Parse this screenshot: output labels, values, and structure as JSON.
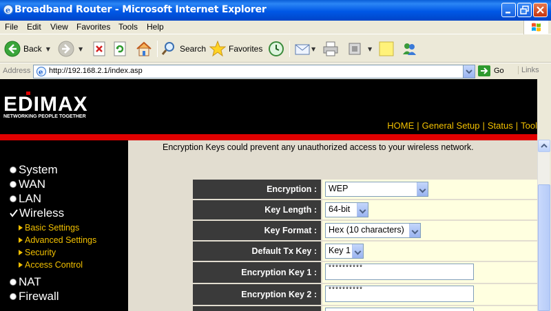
{
  "window": {
    "title": "Broadband Router - Microsoft Internet Explorer"
  },
  "menubar": [
    "File",
    "Edit",
    "View",
    "Favorites",
    "Tools",
    "Help"
  ],
  "toolbar": {
    "back": "Back",
    "search": "Search",
    "favorites": "Favorites"
  },
  "address": {
    "label": "Address",
    "url": "http://192.168.2.1/index.asp",
    "go": "Go",
    "links": "Links"
  },
  "brand": {
    "logo_text": "EDIMAX",
    "tagline": "NETWORKING PEOPLE TOGETHER"
  },
  "toplinks": [
    "HOME",
    "General Setup",
    "Status",
    "Tool"
  ],
  "nav": {
    "main": [
      "System",
      "WAN",
      "LAN",
      "Wireless",
      "NAT",
      "Firewall"
    ],
    "wireless_sub": [
      "Basic Settings",
      "Advanced Settings",
      "Security",
      "Access Control"
    ]
  },
  "content": {
    "intro": "Encryption Keys could prevent any unauthorized access to your wireless network.",
    "fields": [
      {
        "label": "Encryption :",
        "value": "WEP"
      },
      {
        "label": "Key Length :",
        "value": "64-bit"
      },
      {
        "label": "Key Format :",
        "value": "Hex (10 characters)"
      },
      {
        "label": "Default Tx Key :",
        "value": "Key 1"
      },
      {
        "label": "Encryption Key 1 :",
        "value": "**********"
      },
      {
        "label": "Encryption Key 2 :",
        "value": "**********"
      }
    ]
  },
  "colors": {
    "accent_red": "#e00000",
    "link_yellow": "#f2c000",
    "label_bg": "#3a3a3a",
    "value_bg": "#ffffe0"
  }
}
